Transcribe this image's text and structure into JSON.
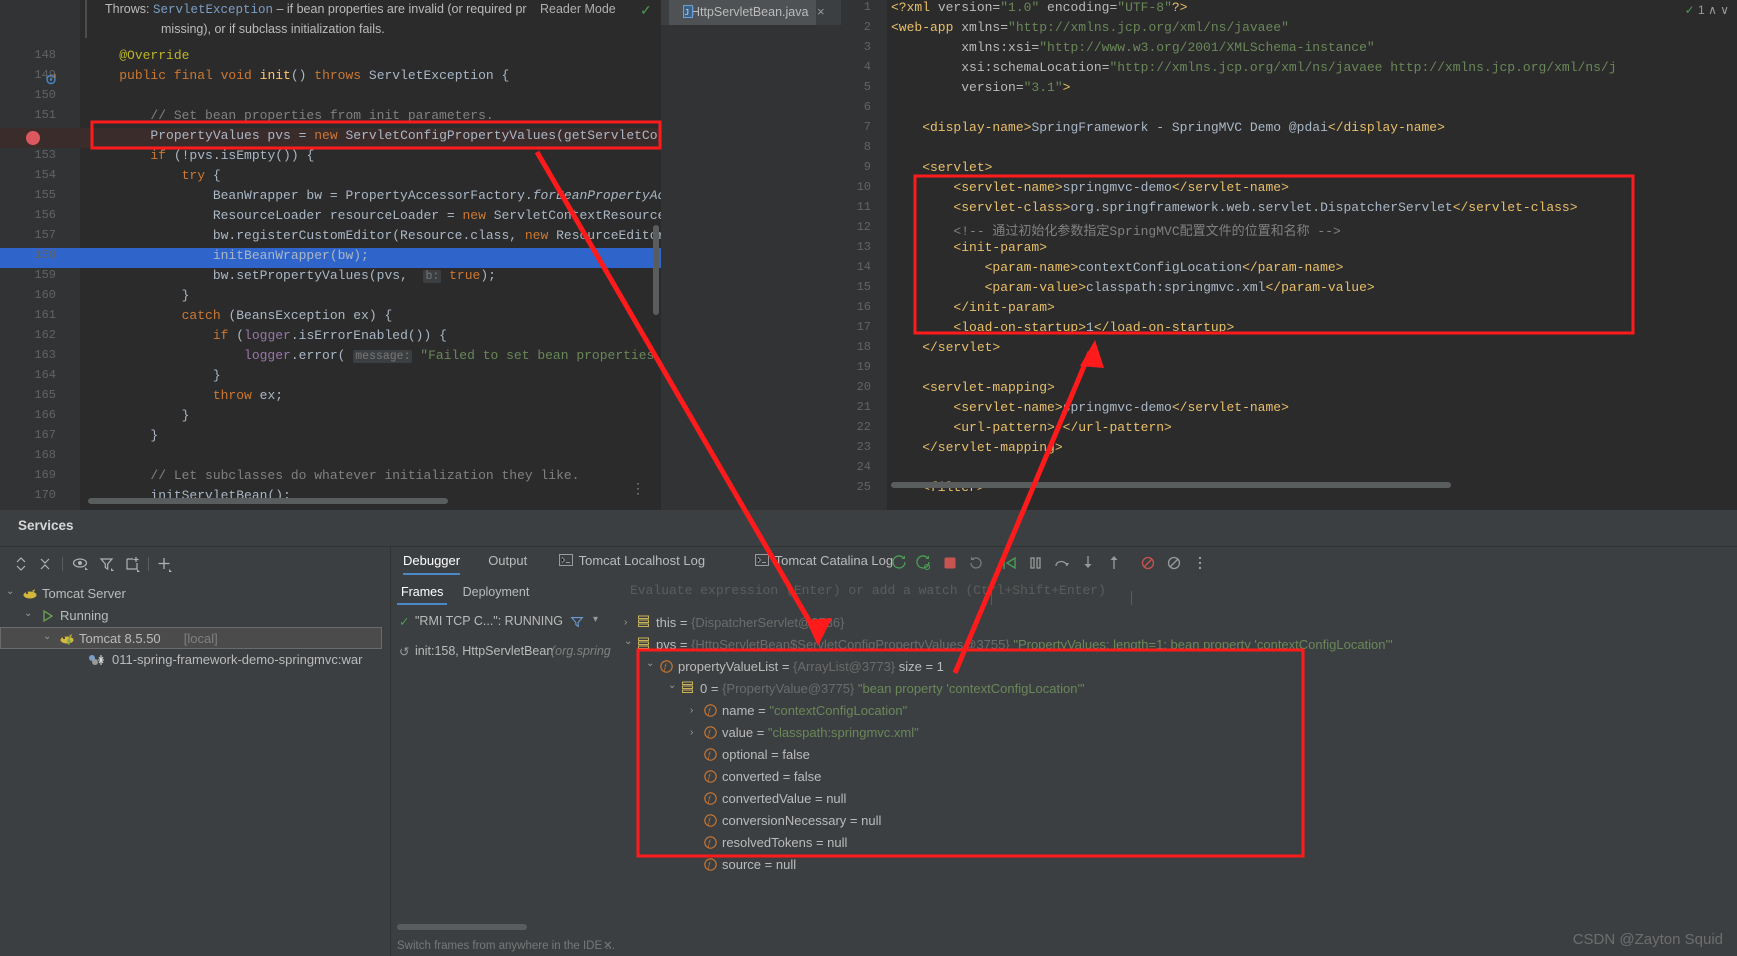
{
  "editor_left": {
    "doc_popup": {
      "prefix": "Throws:",
      "exception": "ServletException",
      "text1": " – if bean properties are invalid (or required pr",
      "text2": "missing), or if subclass initialization fails."
    },
    "reader_mode_label": "Reader Mode",
    "tab": {
      "label": "HttpServletBean.java",
      "close": "×"
    },
    "lines": [
      {
        "num": "148",
        "segments": [
          {
            "t": "    ",
            "c": "t-def"
          },
          {
            "t": "@Override",
            "c": "t-ann"
          }
        ]
      },
      {
        "num": "149",
        "segments": [
          {
            "t": "    ",
            "c": "t-def"
          },
          {
            "t": "public final void ",
            "c": "t-kw"
          },
          {
            "t": "init",
            "c": "t-mth"
          },
          {
            "t": "() ",
            "c": "t-def"
          },
          {
            "t": "throws ",
            "c": "t-kw"
          },
          {
            "t": "ServletException {",
            "c": "t-def"
          }
        ]
      },
      {
        "num": "150",
        "segments": []
      },
      {
        "num": "151",
        "segments": [
          {
            "t": "        // Set bean properties from init parameters.",
            "c": "t-cmt"
          }
        ]
      },
      {
        "num": "152",
        "segments": [
          {
            "t": "        PropertyValues pvs = ",
            "c": "t-def"
          },
          {
            "t": "new ",
            "c": "t-kw"
          },
          {
            "t": "ServletConfigPropertyValues(getServletConfig(), ",
            "c": "t-def"
          }
        ]
      },
      {
        "num": "153",
        "segments": [
          {
            "t": "        ",
            "c": "t-def"
          },
          {
            "t": "if ",
            "c": "t-kw"
          },
          {
            "t": "(!pvs.isEmpty()) {",
            "c": "t-def"
          }
        ]
      },
      {
        "num": "154",
        "segments": [
          {
            "t": "            ",
            "c": "t-def"
          },
          {
            "t": "try ",
            "c": "t-kw"
          },
          {
            "t": "{",
            "c": "t-def"
          }
        ]
      },
      {
        "num": "155",
        "segments": [
          {
            "t": "                BeanWrapper bw = PropertyAccessorFactory.",
            "c": "t-def"
          },
          {
            "t": "forBeanPropertyAccess",
            "c": "t-ital"
          },
          {
            "t": "( tar",
            "c": "t-def"
          }
        ]
      },
      {
        "num": "156",
        "segments": [
          {
            "t": "                ResourceLoader resourceLoader = ",
            "c": "t-def"
          },
          {
            "t": "new ",
            "c": "t-kw"
          },
          {
            "t": "ServletContextResourceLoader(g",
            "c": "t-def"
          }
        ]
      },
      {
        "num": "157",
        "segments": [
          {
            "t": "                bw.registerCustomEditor(Resource.class, ",
            "c": "t-def"
          },
          {
            "t": "new ",
            "c": "t-kw"
          },
          {
            "t": "ResourceEditor(resourc",
            "c": "t-def"
          }
        ]
      },
      {
        "num": "158",
        "segments": [
          {
            "t": "                initBeanWrapper(bw);",
            "c": "t-def"
          }
        ]
      },
      {
        "num": "159",
        "segments": [
          {
            "t": "                bw.setPropertyValues(pvs,  ",
            "c": "t-def"
          },
          {
            "t": "b:",
            "c": "t-hint"
          },
          {
            "t": " ",
            "c": "t-def"
          },
          {
            "t": "true",
            "c": "t-kw"
          },
          {
            "t": ");",
            "c": "t-def"
          }
        ]
      },
      {
        "num": "160",
        "segments": [
          {
            "t": "            }",
            "c": "t-def"
          }
        ]
      },
      {
        "num": "161",
        "segments": [
          {
            "t": "            ",
            "c": "t-def"
          },
          {
            "t": "catch ",
            "c": "t-kw"
          },
          {
            "t": "(BeansException ex) {",
            "c": "t-def"
          }
        ]
      },
      {
        "num": "162",
        "segments": [
          {
            "t": "                ",
            "c": "t-def"
          },
          {
            "t": "if ",
            "c": "t-kw"
          },
          {
            "t": "(",
            "c": "t-def"
          },
          {
            "t": "logger",
            "c": "t-fld"
          },
          {
            "t": ".isErrorEnabled()) {",
            "c": "t-def"
          }
        ]
      },
      {
        "num": "163",
        "segments": [
          {
            "t": "                    ",
            "c": "t-def"
          },
          {
            "t": "logger",
            "c": "t-fld"
          },
          {
            "t": ".error( ",
            "c": "t-def"
          },
          {
            "t": "message:",
            "c": "t-hint"
          },
          {
            "t": " ",
            "c": "t-def"
          },
          {
            "t": "\"Failed to set bean properties on servle",
            "c": "t-str"
          }
        ]
      },
      {
        "num": "164",
        "segments": [
          {
            "t": "                }",
            "c": "t-def"
          }
        ]
      },
      {
        "num": "165",
        "segments": [
          {
            "t": "                ",
            "c": "t-def"
          },
          {
            "t": "throw ",
            "c": "t-kw"
          },
          {
            "t": "ex;",
            "c": "t-def"
          }
        ]
      },
      {
        "num": "166",
        "segments": [
          {
            "t": "            }",
            "c": "t-def"
          }
        ]
      },
      {
        "num": "167",
        "segments": [
          {
            "t": "        }",
            "c": "t-def"
          }
        ]
      },
      {
        "num": "168",
        "segments": []
      },
      {
        "num": "169",
        "segments": [
          {
            "t": "        // Let subclasses do whatever initialization they like.",
            "c": "t-cmt"
          }
        ]
      },
      {
        "num": "170",
        "segments": [
          {
            "t": "        initServletBean();",
            "c": "t-def"
          }
        ]
      }
    ],
    "highlighted_line": "158",
    "breakpoint_line": "152"
  },
  "editor_right": {
    "lines": [
      {
        "num": "1",
        "indent": 0,
        "segments": [
          {
            "t": "<?xml ",
            "c": "x-tag"
          },
          {
            "t": "version=",
            "c": "x-attr"
          },
          {
            "t": "\"1.0\"",
            "c": "x-val"
          },
          {
            "t": " encoding=",
            "c": "x-attr"
          },
          {
            "t": "\"UTF-8\"",
            "c": "x-val"
          },
          {
            "t": "?>",
            "c": "x-tag"
          }
        ]
      },
      {
        "num": "2",
        "indent": 0,
        "segments": [
          {
            "t": "<web-app ",
            "c": "x-tag"
          },
          {
            "t": "xmlns=",
            "c": "x-attr"
          },
          {
            "t": "\"http://xmlns.jcp.org/xml/ns/javaee\"",
            "c": "x-val"
          }
        ]
      },
      {
        "num": "3",
        "indent": 0,
        "segments": [
          {
            "t": "         xmlns:xsi=",
            "c": "x-attr"
          },
          {
            "t": "\"http://www.w3.org/2001/XMLSchema-instance\"",
            "c": "x-val"
          }
        ]
      },
      {
        "num": "4",
        "indent": 0,
        "segments": [
          {
            "t": "         xsi:schemaLocation=",
            "c": "x-attr"
          },
          {
            "t": "\"http://xmlns.jcp.org/xml/ns/javaee http://xmlns.jcp.org/xml/ns/j",
            "c": "x-val"
          }
        ]
      },
      {
        "num": "5",
        "indent": 0,
        "segments": [
          {
            "t": "         version=",
            "c": "x-attr"
          },
          {
            "t": "\"3.1\"",
            "c": "x-val"
          },
          {
            "t": ">",
            "c": "x-tag"
          }
        ]
      },
      {
        "num": "6",
        "indent": 0,
        "segments": []
      },
      {
        "num": "7",
        "indent": 0,
        "segments": [
          {
            "t": "    <display-name>",
            "c": "x-tag"
          },
          {
            "t": "SpringFramework - SpringMVC Demo @pdai",
            "c": "x-txt"
          },
          {
            "t": "</display-name>",
            "c": "x-tag"
          }
        ]
      },
      {
        "num": "8",
        "indent": 0,
        "segments": []
      },
      {
        "num": "9",
        "indent": 0,
        "segments": [
          {
            "t": "    <servlet>",
            "c": "x-tag"
          }
        ]
      },
      {
        "num": "10",
        "indent": 0,
        "segments": [
          {
            "t": "        <servlet-name>",
            "c": "x-tag"
          },
          {
            "t": "springmvc-demo",
            "c": "x-txt"
          },
          {
            "t": "</servlet-name>",
            "c": "x-tag"
          }
        ]
      },
      {
        "num": "11",
        "indent": 0,
        "segments": [
          {
            "t": "        <servlet-class>",
            "c": "x-tag"
          },
          {
            "t": "org.springframework.web.servlet.DispatcherServlet",
            "c": "x-txt"
          },
          {
            "t": "</servlet-class>",
            "c": "x-tag"
          }
        ]
      },
      {
        "num": "12",
        "indent": 0,
        "segments": [
          {
            "t": "        <!-- 通过初始化参数指定SpringMVC配置文件的位置和名称 -->",
            "c": "x-cmt"
          }
        ]
      },
      {
        "num": "13",
        "indent": 0,
        "segments": [
          {
            "t": "        <init-param>",
            "c": "x-tag"
          }
        ]
      },
      {
        "num": "14",
        "indent": 0,
        "segments": [
          {
            "t": "            <param-name>",
            "c": "x-tag"
          },
          {
            "t": "contextConfigLocation",
            "c": "x-txt"
          },
          {
            "t": "</param-name>",
            "c": "x-tag"
          }
        ]
      },
      {
        "num": "15",
        "indent": 0,
        "segments": [
          {
            "t": "            <param-value>",
            "c": "x-tag"
          },
          {
            "t": "classpath:springmvc.xml",
            "c": "x-txt"
          },
          {
            "t": "</param-value>",
            "c": "x-tag"
          }
        ]
      },
      {
        "num": "16",
        "indent": 0,
        "segments": [
          {
            "t": "        </init-param>",
            "c": "x-tag"
          }
        ]
      },
      {
        "num": "17",
        "indent": 0,
        "segments": [
          {
            "t": "        <load-on-startup>",
            "c": "x-tag"
          },
          {
            "t": "1",
            "c": "x-txt"
          },
          {
            "t": "</load-on-startup>",
            "c": "x-tag"
          }
        ]
      },
      {
        "num": "18",
        "indent": 0,
        "segments": [
          {
            "t": "    </servlet>",
            "c": "x-tag"
          }
        ]
      },
      {
        "num": "19",
        "indent": 0,
        "segments": []
      },
      {
        "num": "20",
        "indent": 0,
        "segments": [
          {
            "t": "    <servlet-mapping>",
            "c": "x-tag"
          }
        ]
      },
      {
        "num": "21",
        "indent": 0,
        "segments": [
          {
            "t": "        <servlet-name>",
            "c": "x-tag"
          },
          {
            "t": "springmvc-demo",
            "c": "x-txt"
          },
          {
            "t": "</servlet-name>",
            "c": "x-tag"
          }
        ]
      },
      {
        "num": "22",
        "indent": 0,
        "segments": [
          {
            "t": "        <url-pattern>",
            "c": "x-tag"
          },
          {
            "t": "/",
            "c": "x-txt"
          },
          {
            "t": "</url-pattern>",
            "c": "x-tag"
          }
        ]
      },
      {
        "num": "23",
        "indent": 0,
        "segments": [
          {
            "t": "    </servlet-mapping>",
            "c": "x-tag"
          }
        ]
      },
      {
        "num": "24",
        "indent": 0,
        "segments": []
      },
      {
        "num": "25",
        "indent": 0,
        "segments": [
          {
            "t": "    <filter>",
            "c": "x-tag"
          }
        ]
      }
    ],
    "status": {
      "warnings": "1",
      "up": "∧",
      "down": "∨",
      "check": "✓"
    }
  },
  "services": {
    "title": "Services",
    "toolbar_icons": [
      {
        "name": "expand-collapse-icon",
        "glyph": "⌃"
      },
      {
        "name": "collapse-all-icon",
        "glyph": "✕"
      },
      {
        "name": "eye-icon",
        "glyph": "◉"
      },
      {
        "name": "filter-icon",
        "glyph": "▽"
      },
      {
        "name": "add-config-icon",
        "glyph": "▭"
      },
      {
        "name": "plus-icon",
        "glyph": "＋"
      }
    ],
    "tree": [
      {
        "label": "Tomcat Server",
        "suffix": "",
        "indent": 22,
        "chev": "⌄",
        "icon": "tomcat-icon",
        "selected": false
      },
      {
        "label": "Running",
        "suffix": "",
        "indent": 40,
        "chev": "⌄",
        "icon": "run-icon",
        "selected": false
      },
      {
        "label": "Tomcat 8.5.50",
        "suffix": "[local]",
        "indent": 58,
        "chev": "⌄",
        "icon": "tomcat-icon",
        "selected": true
      },
      {
        "label": "011-spring-framework-demo-springmvc:war",
        "suffix": "",
        "indent": 88,
        "chev": "",
        "icon": "artifact-icon",
        "selected": false
      }
    ]
  },
  "debugger": {
    "tabs": [
      {
        "label": "Debugger",
        "active": true,
        "icon": ""
      },
      {
        "label": "Output",
        "active": false,
        "icon": ""
      },
      {
        "label": "Tomcat Localhost Log",
        "active": false,
        "icon": "console-icon"
      },
      {
        "label": "Tomcat Catalina Log",
        "active": false,
        "icon": "console-icon"
      }
    ],
    "toolbar_icons": [
      {
        "name": "rerun-icon",
        "glyph": "↻"
      },
      {
        "name": "rerun-debug-icon",
        "glyph": "↻"
      },
      {
        "name": "stop-icon",
        "glyph": "■"
      },
      {
        "name": "restart-icon",
        "glyph": "↺"
      },
      {
        "name": "resume-program-icon",
        "glyph": "▷"
      },
      {
        "name": "pause-program-icon",
        "glyph": "‖"
      },
      {
        "name": "step-over-icon",
        "glyph": "⤴"
      },
      {
        "name": "step-into-icon",
        "glyph": "↓"
      },
      {
        "name": "step-out-icon",
        "glyph": "↑"
      },
      {
        "name": "mute-breakpoints-icon",
        "glyph": "◎"
      },
      {
        "name": "view-breakpoints-icon",
        "glyph": "⊘"
      },
      {
        "name": "more-options-icon",
        "glyph": "⋮"
      }
    ],
    "frames": {
      "tabs": [
        {
          "label": "Frames",
          "active": true
        },
        {
          "label": "Deployment",
          "active": false
        }
      ],
      "thread": "\"RMI TCP C...\": RUNNING",
      "frame": "init:158, HttpServletBean",
      "frame_pkg": "(org.spring",
      "filter_icon": "filter-icon",
      "dropdown_icon": "chevron-down-icon",
      "hint": "Switch frames from anywhere in the IDE ...",
      "hint_close": "✕"
    },
    "evaluate_placeholder": "Evaluate expression (Enter) or add a watch (Ctrl+Shift+Enter)",
    "variables": [
      {
        "indent": 14,
        "chev": "›",
        "icon": "object-icon",
        "name": "this",
        "eq": " = ",
        "ref": "{DispatcherServlet@3736}",
        "value": "",
        "depth": 0
      },
      {
        "indent": 14,
        "chev": "⌄",
        "icon": "object-icon",
        "name": "pvs",
        "eq": " = ",
        "ref": "{HttpServletBean$ServletConfigPropertyValues@3755}",
        "value": "\"PropertyValues: length=1; bean property 'contextConfigLocation'\"",
        "depth": 0
      },
      {
        "indent": 36,
        "chev": "⌄",
        "icon": "field-icon",
        "name": "propertyValueList",
        "eq": " = ",
        "ref": "{ArrayList@3773}",
        "value": "  size = 1",
        "depth": 1
      },
      {
        "indent": 58,
        "chev": "⌄",
        "icon": "object-icon",
        "name": "0",
        "eq": " = ",
        "ref": "{PropertyValue@3775}",
        "value": "\"bean property 'contextConfigLocation'\"",
        "depth": 2
      },
      {
        "indent": 80,
        "chev": "›",
        "icon": "field-icon",
        "name": "name",
        "eq": " = ",
        "ref": "",
        "value": "\"contextConfigLocation\"",
        "depth": 3
      },
      {
        "indent": 80,
        "chev": "›",
        "icon": "field-icon",
        "name": "value",
        "eq": " = ",
        "ref": "",
        "value": "\"classpath:springmvc.xml\"",
        "depth": 3
      },
      {
        "indent": 80,
        "chev": "",
        "icon": "field-icon",
        "name": "optional",
        "eq": " = ",
        "ref": "",
        "value": "false",
        "depth": 3
      },
      {
        "indent": 80,
        "chev": "",
        "icon": "field-icon",
        "name": "converted",
        "eq": " = ",
        "ref": "",
        "value": "false",
        "depth": 3
      },
      {
        "indent": 80,
        "chev": "",
        "icon": "field-icon",
        "name": "convertedValue",
        "eq": " = ",
        "ref": "",
        "value": "null",
        "depth": 3
      },
      {
        "indent": 80,
        "chev": "",
        "icon": "field-icon",
        "name": "conversionNecessary",
        "eq": " = ",
        "ref": "",
        "value": "null",
        "depth": 3
      },
      {
        "indent": 80,
        "chev": "",
        "icon": "field-icon",
        "name": "resolvedTokens",
        "eq": " = ",
        "ref": "",
        "value": "null",
        "depth": 3
      },
      {
        "indent": 80,
        "chev": "",
        "icon": "field-icon",
        "name": "source",
        "eq": " = ",
        "ref": "",
        "value": "null",
        "depth": 3
      }
    ]
  },
  "watermark": "CSDN @Zayton Squid",
  "colors": {
    "annotation_red": "#ff1b1b",
    "accent_blue": "#4a88c7",
    "selection_blue": "#2f65ca",
    "editor_bg": "#2b2b2b",
    "panel_bg": "#3c3f41",
    "string_green": "#6a8759",
    "keyword_orange": "#cc7832"
  }
}
